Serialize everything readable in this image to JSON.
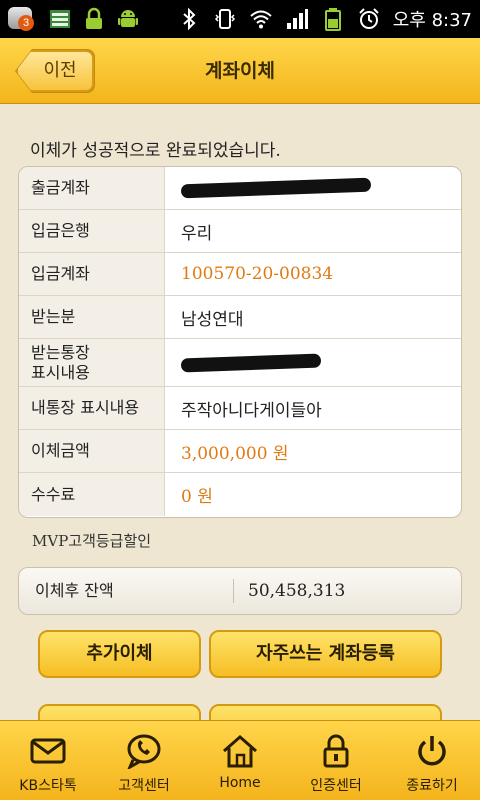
{
  "status_bar": {
    "notification_count": "3",
    "time": "오후 8:37"
  },
  "header": {
    "back_label": "이전",
    "title": "계좌이체"
  },
  "transfer": {
    "result_message": "이체가 성공적으로 완료되었습니다.",
    "rows": [
      {
        "label": "출금계좌",
        "value": ""
      },
      {
        "label": "입금은행",
        "value": "우리"
      },
      {
        "label": "입금계좌",
        "value": "100570-20-00834"
      },
      {
        "label": "받는분",
        "value": "남성연대"
      },
      {
        "label": "받는통장\n표시내용",
        "value": ""
      },
      {
        "label": "내통장 표시내용",
        "value": "주작아니다게이들아"
      },
      {
        "label": "이체금액",
        "value": "3,000,000 원"
      },
      {
        "label": "수수료",
        "value": "0 원"
      }
    ],
    "mvp_note": "MVP고객등급할인",
    "balance_label": "이체후 잔액",
    "balance_value": "50,458,313"
  },
  "actions": {
    "add_transfer": "추가이체",
    "register_favorite": "자주쓰는 계좌등록"
  },
  "bottom_nav": [
    {
      "label": "KB스타톡",
      "icon": "mail-icon"
    },
    {
      "label": "고객센터",
      "icon": "phone-chat-icon"
    },
    {
      "label": "Home",
      "icon": "home-icon"
    },
    {
      "label": "인증센터",
      "icon": "lock-icon"
    },
    {
      "label": "종료하기",
      "icon": "power-icon"
    }
  ],
  "colors": {
    "accent_yellow": "#f5be23",
    "value_orange": "#e17a12"
  }
}
